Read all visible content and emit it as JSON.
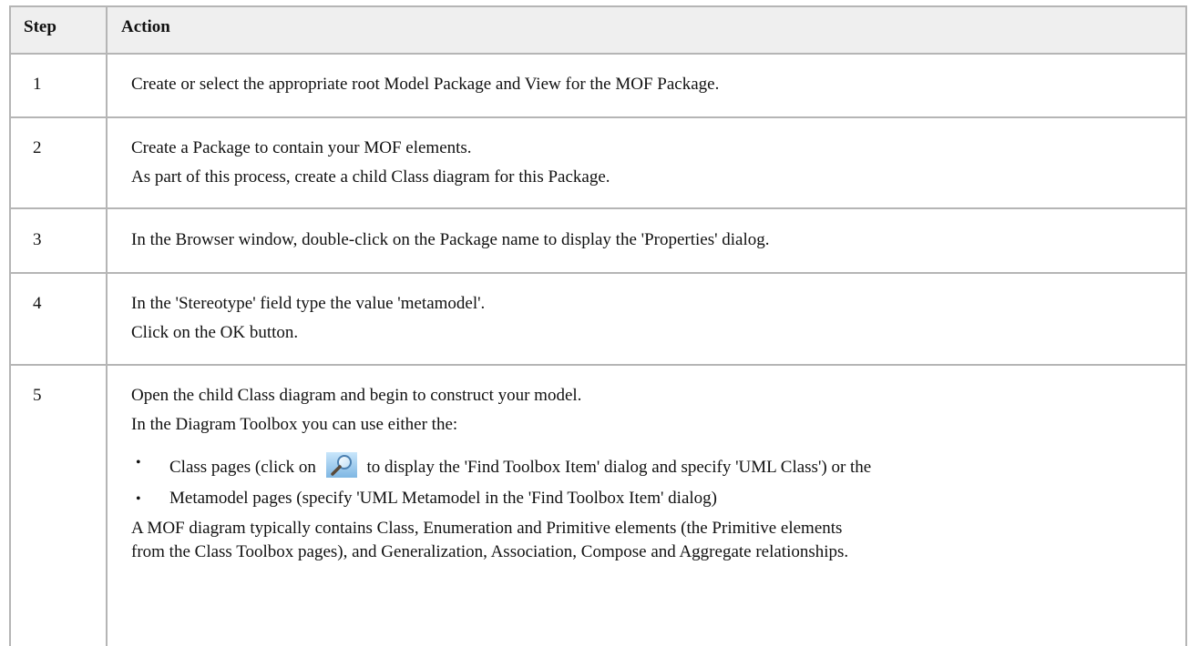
{
  "table": {
    "header": {
      "step": "Step",
      "action": "Action"
    },
    "rows": [
      {
        "step": "1",
        "lines": [
          "Create or select the appropriate root Model Package and View for the MOF Package."
        ]
      },
      {
        "step": "2",
        "lines": [
          "Create a Package to contain your MOF elements.",
          "As part of this process, create a child Class diagram for this Package."
        ]
      },
      {
        "step": "3",
        "lines": [
          "In the Browser window, double-click on the Package name to display the 'Properties' dialog."
        ]
      },
      {
        "step": "4",
        "lines": [
          "In the 'Stereotype' field type the value 'metamodel'.",
          "Click on the OK button."
        ]
      },
      {
        "step": "5",
        "lines": [
          "Open the child Class diagram and begin to construct your model.",
          "In the Diagram Toolbox you can use either the:"
        ],
        "bullets": [
          {
            "before": "Class pages (click on",
            "icon": "find-toolbox-icon",
            "after": "to display the 'Find Toolbox Item' dialog and specify 'UML Class') or the"
          },
          {
            "text": "Metamodel pages (specify 'UML Metamodel in the 'Find Toolbox Item' dialog)"
          }
        ],
        "footer": [
          "A MOF diagram typically contains Class, Enumeration and Primitive elements (the Primitive elements",
          "from the Class Toolbox pages), and Generalization, Association, Compose and Aggregate relationships."
        ]
      }
    ],
    "bullet_glyph": "•"
  }
}
